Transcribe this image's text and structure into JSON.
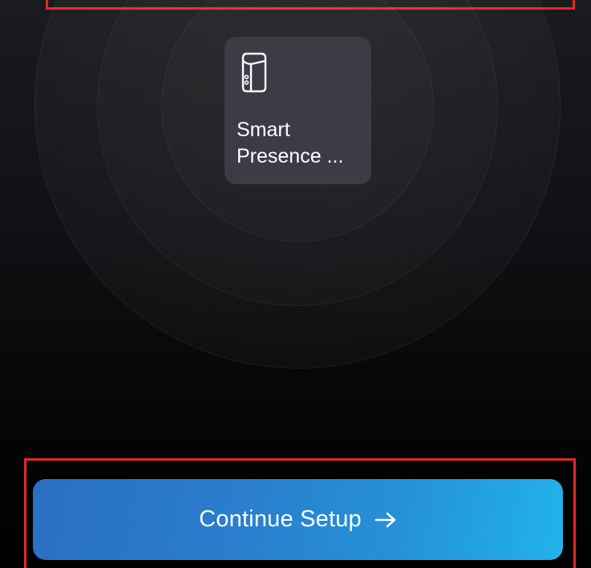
{
  "device": {
    "name": "Smart\nPresence ...",
    "icon": "hub-device-icon"
  },
  "actions": {
    "continue_label": "Continue Setup",
    "continue_icon": "arrow-right-icon"
  },
  "colors": {
    "background": "#000000",
    "card": "#3b3c46",
    "button_start": "#2b6fc0",
    "button_end": "#21b3e9",
    "highlight": "#e8262b"
  }
}
